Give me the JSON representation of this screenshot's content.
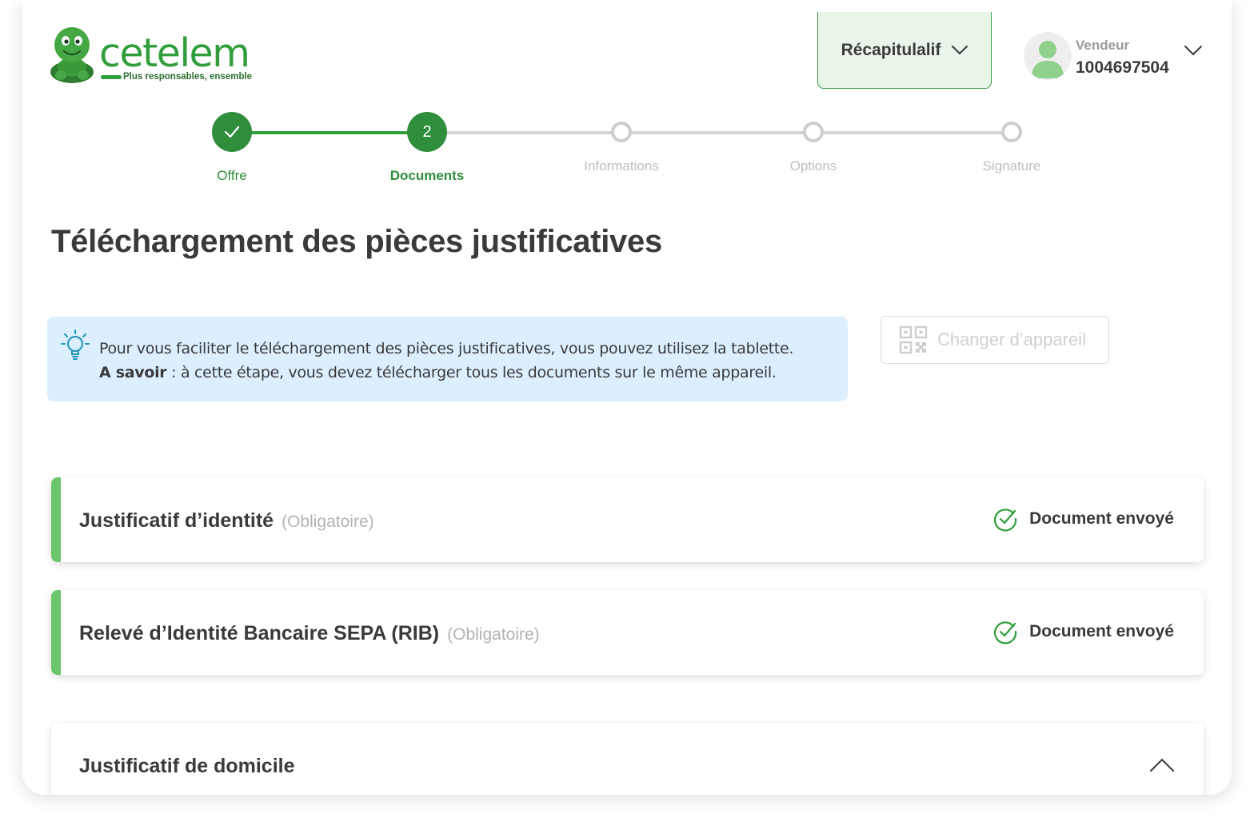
{
  "brand": {
    "name": "cetelem",
    "tagline": "Plus responsables, ensemble",
    "color": "#2f9e3b"
  },
  "header": {
    "summary_label": "Récapitulalif",
    "user_role": "Vendeur",
    "user_id": "1004697504"
  },
  "stepper": {
    "steps": [
      {
        "label": "Offre",
        "state": "done"
      },
      {
        "label": "Documents",
        "state": "current",
        "number": "2"
      },
      {
        "label": "Informations",
        "state": "todo"
      },
      {
        "label": "Options",
        "state": "todo"
      },
      {
        "label": "Signature",
        "state": "todo"
      }
    ]
  },
  "page": {
    "title": "Téléchargement des pièces justificatives"
  },
  "info": {
    "line1": "Pour vous faciliter le téléchargement des pièces justificatives, vous pouvez  utilisez la tablette.",
    "line2_bold": "A savoir",
    "line2_rest": " : à cette étape, vous devez télécharger tous les documents sur le même appareil.",
    "icon": "lightbulb-icon"
  },
  "device_button": {
    "label": "Changer d’appareil",
    "icon": "qr-code-icon",
    "disabled": true
  },
  "documents": [
    {
      "title": "Justificatif d’identité",
      "requirement": "(Obligatoire)",
      "status": "Document envoyé"
    },
    {
      "title": "Relevé d’Identité Bancaire SEPA (RIB)",
      "requirement": "(Obligatoire)",
      "status": "Document envoyé"
    },
    {
      "title": "Justificatif de domicile",
      "requirement": "",
      "status": ""
    }
  ]
}
